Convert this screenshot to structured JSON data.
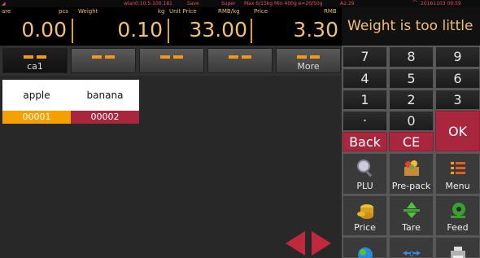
{
  "status_bar": {
    "network": "wlan0:10.5.100.181",
    "save": "Save",
    "mode": "Super",
    "capacity": "Max 6/15kg Min 400g e=20/50g",
    "code": "A2:29",
    "datetime": "20161103 09:59"
  },
  "display": {
    "tare_label": "are",
    "tare_value": "0.00",
    "pcs_label": "pcs",
    "weight_label": "Weight",
    "weight_unit": "kg",
    "weight_value": "0.10",
    "unit_price_label": "Unit Price",
    "unit_price_unit": "RMB/kg",
    "unit_price_value": "33.00",
    "price_label": "Price",
    "price_unit": "RMB",
    "price_value": "3.30"
  },
  "message": "Weight is too little",
  "tabs": [
    {
      "label": "ca1"
    },
    {
      "label": ""
    },
    {
      "label": ""
    },
    {
      "label": ""
    },
    {
      "label": "More"
    }
  ],
  "items": [
    {
      "name": "apple",
      "code": "00001",
      "color": "#f5a000"
    },
    {
      "name": "banana",
      "code": "00002",
      "color": "#a8263e"
    }
  ],
  "keypad": {
    "digits": [
      "7",
      "8",
      "9",
      "4",
      "5",
      "6",
      "1",
      "2",
      "3",
      ".",
      "0"
    ],
    "ok": "OK",
    "back": "Back",
    "ce": "CE",
    "functions": [
      "PLU",
      "Pre-pack",
      "Menu",
      "Price",
      "Tare",
      "Feed"
    ]
  },
  "colors": {
    "accent": "#f09a18",
    "red": "#a8263e",
    "display_text": "#f2c070"
  }
}
